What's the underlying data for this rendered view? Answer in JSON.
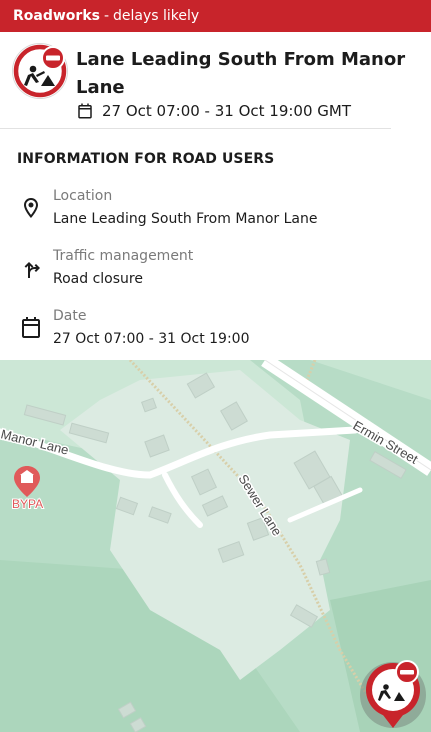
{
  "banner": {
    "strong": "Roadworks",
    "separator": "-",
    "text": "delays likely",
    "color": "#c8242b"
  },
  "event": {
    "title": "Lane Leading South From Manor Lane",
    "date_range": "27 Oct 07:00 - 31 Oct 19:00 GMT"
  },
  "info": {
    "heading": "INFORMATION FOR ROAD USERS",
    "rows": [
      {
        "label": "Location",
        "value": "Lane Leading South From Manor Lane",
        "icon": "location-pin-icon"
      },
      {
        "label": "Traffic management",
        "value": "Road closure",
        "icon": "diversion-arrow-icon"
      },
      {
        "label": "Date",
        "value": "27 Oct 07:00 - 31 Oct 19:00",
        "icon": "calendar-icon"
      }
    ]
  },
  "map": {
    "streets": [
      "Manor Lane",
      "Ermin Street",
      "Sewer Lane"
    ],
    "poi": {
      "label": "BYPA",
      "icon": "museum-pin-icon"
    },
    "marker": "roadworks-marker-icon"
  }
}
